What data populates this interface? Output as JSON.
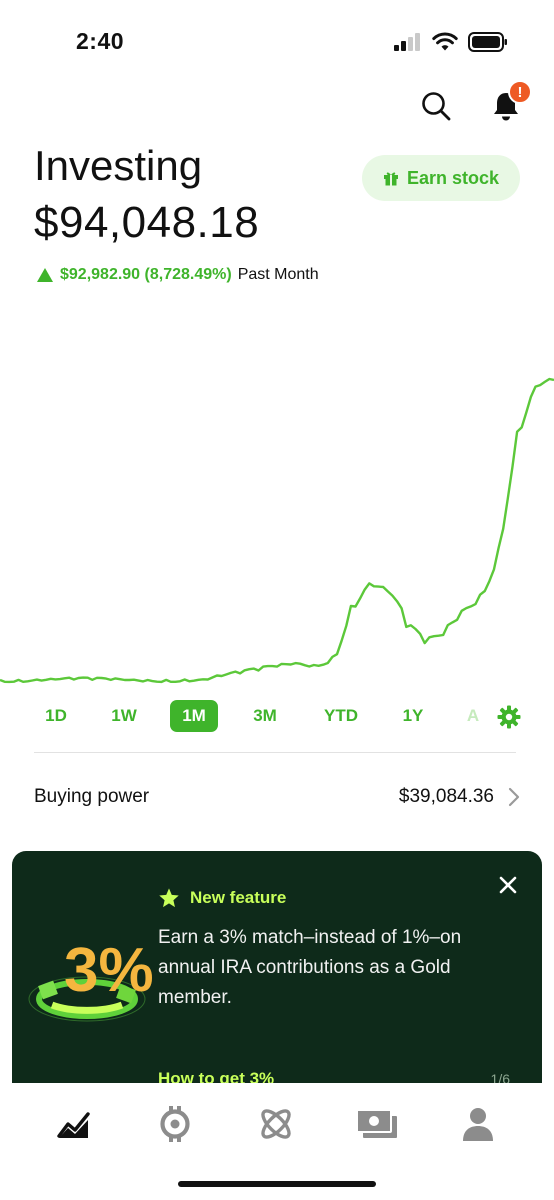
{
  "status_bar": {
    "time": "2:40"
  },
  "header": {
    "title": "Investing",
    "value": "$94,048.18",
    "earn_button": "Earn stock",
    "notification_badge": "!"
  },
  "change": {
    "amount": "$92,982.90 (8,728.49%)",
    "period": "Past Month"
  },
  "chart_data": {
    "type": "line",
    "series": [
      {
        "values": [
          1065,
          1070,
          1180,
          1230,
          1210,
          1120,
          1080,
          1060,
          1050,
          1080,
          1200,
          1280,
          2300,
          3100,
          4000,
          5200,
          6300,
          5700,
          8200,
          24000,
          31000,
          28500,
          17500,
          12500,
          15000,
          22500,
          27500,
          42000,
          78000,
          92000,
          94048.18
        ]
      }
    ],
    "color": "#5cc83a",
    "grid": false
  },
  "ranges": {
    "items": [
      "1D",
      "1W",
      "1M",
      "3M",
      "YTD",
      "1Y",
      "A"
    ],
    "active": "1M"
  },
  "buying_power": {
    "label": "Buying power",
    "value": "$39,084.36"
  },
  "promo": {
    "tag": "New feature",
    "body": "Earn a 3% match–instead of 1%–on annual IRA contributions as a Gold member.",
    "link": "How to get 3%",
    "page": "1/6",
    "graphic_text": "3%"
  },
  "tabs": [
    "investing",
    "crypto",
    "retirement",
    "spending",
    "account"
  ],
  "colors": {
    "accent": "#3fb42b",
    "promo_bg": "#0e2a1a",
    "promo_accent": "#c8ff5a",
    "badge": "#ee5a24"
  }
}
